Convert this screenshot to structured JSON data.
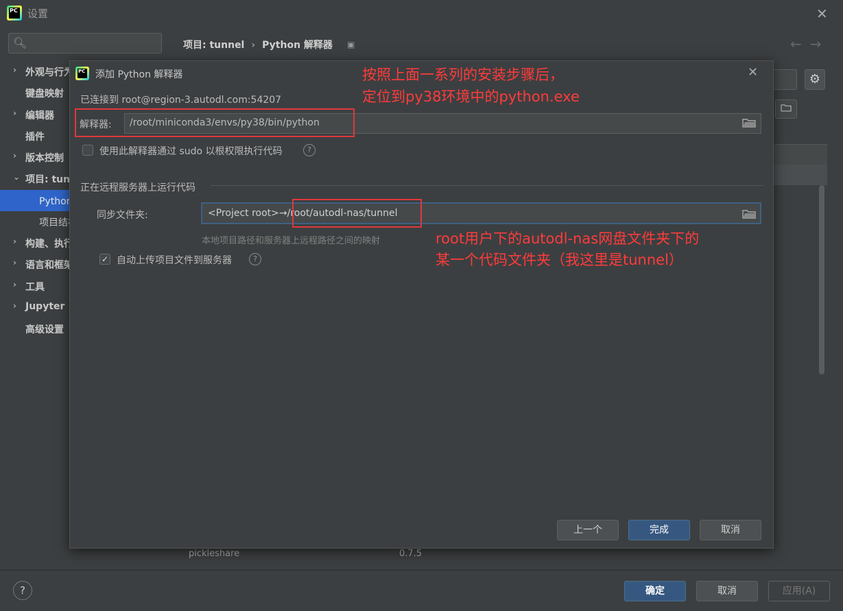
{
  "window": {
    "title": "设置",
    "close_symbol": "✕"
  },
  "search": {
    "placeholder": "",
    "icon_glyph": "🔍︎"
  },
  "sidebar": {
    "items": [
      {
        "label": "外观与行为",
        "arrow": "›"
      },
      {
        "label": "键盘映射",
        "arrow": ""
      },
      {
        "label": "编辑器",
        "arrow": "›"
      },
      {
        "label": "插件",
        "arrow": ""
      },
      {
        "label": "版本控制",
        "arrow": "›"
      },
      {
        "label": "项目: tunnel",
        "arrow": "⌄"
      },
      {
        "label": "Python 解释器",
        "arrow": ""
      },
      {
        "label": "项目结构",
        "arrow": ""
      },
      {
        "label": "构建、执行、部署",
        "arrow": "›"
      },
      {
        "label": "语言和框架",
        "arrow": "›"
      },
      {
        "label": "工具",
        "arrow": "›"
      },
      {
        "label": "Jupyter",
        "arrow": "›"
      },
      {
        "label": "高级设置",
        "arrow": ""
      }
    ]
  },
  "breadcrumb": {
    "project": "项目: tunnel",
    "separator": "›",
    "page": "Python 解释器",
    "icon_glyph": "▣",
    "nav_arrows": "←→"
  },
  "background_table": {
    "package_name": "pickleshare",
    "package_version": "0.7.5"
  },
  "dialog": {
    "title": "添加 Python 解释器",
    "close_symbol": "✕",
    "connected": "已连接到 root@region-3.autodl.com:54207",
    "interpreter_label": "解释器:",
    "interpreter_value": "/root/miniconda3/envs/py38/bin/python",
    "sudo_label": "使用此解释器通过 sudo 以根权限执行代码",
    "section_title": "正在远程服务器上运行代码",
    "sync_label": "同步文件夹:",
    "sync_value": "<Project root>→/root/autodl-nas/tunnel",
    "sync_hint": "本地项目路径和服务器上远程路径之间的映射",
    "auto_upload_label": "自动上传项目文件到服务器",
    "auto_upload_checked": true,
    "help_symbol": "?",
    "buttons": {
      "previous": "上一个",
      "finish": "完成",
      "cancel": "取消"
    }
  },
  "annotations": {
    "note1_line1": "按照上面一系列的安装步骤后，",
    "note1_line2": "定位到py38环境中的python.exe",
    "note2_line1": "root用户下的autodl-nas网盘文件夹下的",
    "note2_line2": "某一个代码文件夹（我这里是tunnel）",
    "color": "#ff3b3b"
  },
  "footer": {
    "help_symbol": "?",
    "ok": "确定",
    "cancel": "取消",
    "apply": "应用(A)"
  }
}
